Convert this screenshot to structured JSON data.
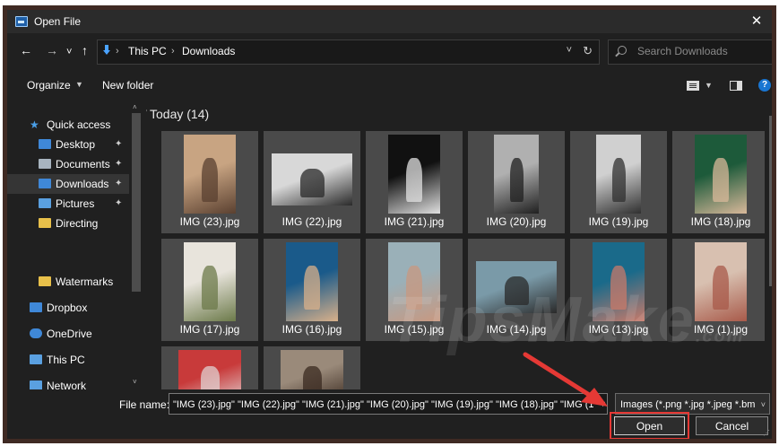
{
  "window": {
    "title": "Open File",
    "close_glyph": "✕"
  },
  "nav": {
    "back_glyph": "←",
    "forward_glyph": "→",
    "recent_glyph": "˅",
    "up_glyph": "↑",
    "breadcrumb": [
      "This PC",
      "Downloads"
    ],
    "crumb_sep": "›",
    "dropdown_glyph": "˅",
    "refresh_glyph": "↻"
  },
  "search": {
    "placeholder": "Search Downloads"
  },
  "toolbar": {
    "organize_label": "Organize",
    "organize_caret": "▼",
    "new_folder_label": "New folder",
    "view_caret": "▼",
    "help_label": "?"
  },
  "sidebar": {
    "items": [
      {
        "label": "Quick access",
        "icon": "star-icon",
        "pinned": false
      },
      {
        "label": "Desktop",
        "icon": "desktop-folder-icon",
        "pinned": true
      },
      {
        "label": "Documents",
        "icon": "documents-icon",
        "pinned": true
      },
      {
        "label": "Downloads",
        "icon": "download-icon",
        "pinned": true,
        "selected": true
      },
      {
        "label": "Pictures",
        "icon": "pictures-icon",
        "pinned": true
      },
      {
        "label": "Directing",
        "icon": "folder-icon",
        "pinned": false
      },
      {
        "label": "Watermarks",
        "icon": "folder-icon",
        "pinned": false
      },
      {
        "label": "Dropbox",
        "icon": "dropbox-icon",
        "pinned": false
      },
      {
        "label": "OneDrive",
        "icon": "cloud-icon",
        "pinned": false
      },
      {
        "label": "This PC",
        "icon": "computer-icon",
        "pinned": false
      },
      {
        "label": "Network",
        "icon": "network-icon",
        "pinned": false
      }
    ],
    "pin_glyph": "📌",
    "scroll_up": "˄",
    "scroll_down": "˅"
  },
  "content": {
    "group_label": "Today (14)",
    "group_caret": "˅",
    "files": [
      {
        "name": "IMG (23).jpg",
        "colors": [
          "#c8a482",
          "#5a4030"
        ]
      },
      {
        "name": "IMG (22).jpg",
        "colors": [
          "#d8d8d8",
          "#2a2a2a"
        ]
      },
      {
        "name": "IMG (21).jpg",
        "colors": [
          "#111111",
          "#e0e0e0"
        ]
      },
      {
        "name": "IMG (20).jpg",
        "colors": [
          "#b0b0b0",
          "#202020"
        ]
      },
      {
        "name": "IMG (19).jpg",
        "colors": [
          "#d0d0d0",
          "#303030"
        ]
      },
      {
        "name": "IMG (18).jpg",
        "colors": [
          "#1d5a3a",
          "#d8b89a"
        ]
      },
      {
        "name": "IMG (17).jpg",
        "colors": [
          "#e8e4dc",
          "#6c7a4a"
        ]
      },
      {
        "name": "IMG (16).jpg",
        "colors": [
          "#1a5a8a",
          "#d8b08a"
        ]
      },
      {
        "name": "IMG (15).jpg",
        "colors": [
          "#9ab0b8",
          "#c89880"
        ]
      },
      {
        "name": "IMG (14).jpg",
        "colors": [
          "#7a9aa8",
          "#2a2a2a"
        ]
      },
      {
        "name": "IMG (13).jpg",
        "colors": [
          "#1a6a8a",
          "#c87a6a"
        ]
      },
      {
        "name": "IMG (1).jpg",
        "colors": [
          "#d8c0b0",
          "#a85a4a"
        ]
      },
      {
        "name": "",
        "colors": [
          "#c83a3a",
          "#e0d0d0"
        ]
      },
      {
        "name": "",
        "colors": [
          "#9a8a7a",
          "#3a2a20"
        ]
      }
    ]
  },
  "footer": {
    "file_name_label": "File name:",
    "file_name_value": "\"IMG (23).jpg\" \"IMG (22).jpg\" \"IMG (21).jpg\" \"IMG (20).jpg\" \"IMG (19).jpg\" \"IMG (18).jpg\" \"IMG (1",
    "file_name_caret": "▼",
    "filter_value": "Images (*.png *.jpg *.jpeg *.bm",
    "filter_caret": "˅",
    "open_label": "Open",
    "cancel_label": "Cancel"
  },
  "watermark": {
    "text": "TipsMake",
    "suffix": ".com"
  },
  "colors": {
    "accent": "#1976d2",
    "highlight": "#e53935",
    "frame": "#3f2a23"
  }
}
